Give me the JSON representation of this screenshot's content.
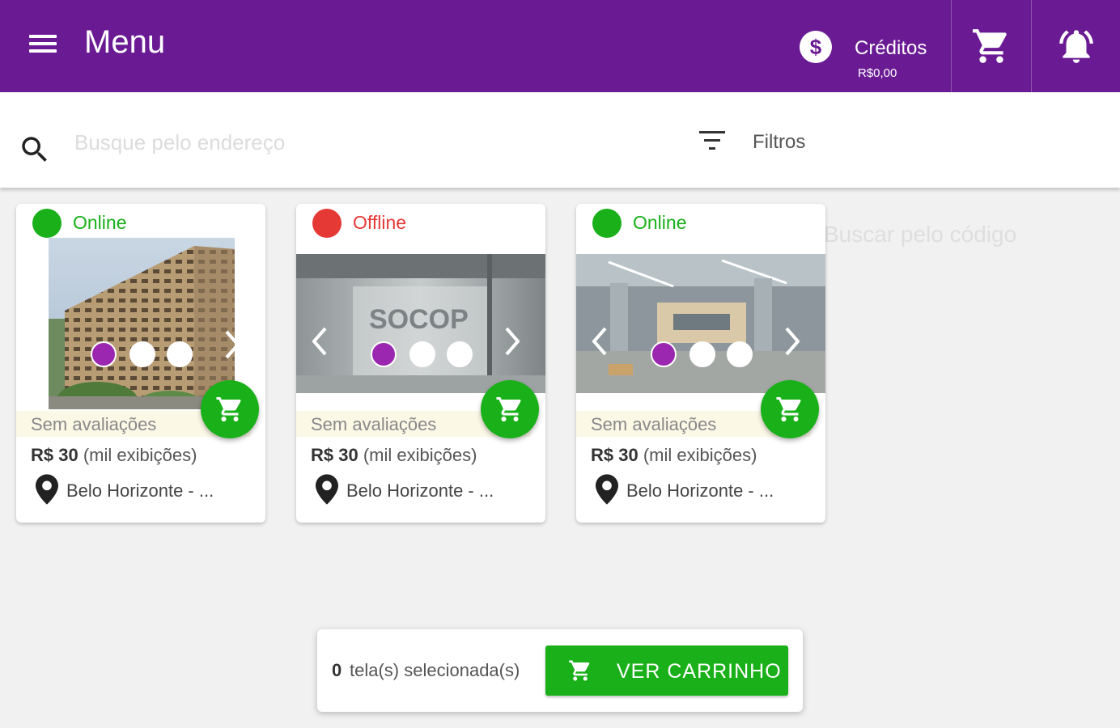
{
  "header": {
    "title": "Menu",
    "credits_label": "Créditos",
    "credits_value": "R$0,00",
    "icons": [
      "menu-icon",
      "dollar-coin-icon",
      "cart-icon",
      "bell-icon"
    ],
    "background_color": "#6a1b94"
  },
  "search": {
    "placeholder": "Busque pelo endereço",
    "filters_label": "Filtros",
    "code_placeholder": "Buscar pelo código"
  },
  "cards": [
    {
      "status": "Online",
      "status_color": "#1ab01a",
      "rating": "Sem avaliações",
      "price_bold": "R$ 30",
      "price_rest": " (mil exibições)",
      "location": "Belo Horizonte - ...",
      "carousel_active_index": 0
    },
    {
      "status": "Offline",
      "status_color": "#e53935",
      "rating": "Sem avaliações",
      "price_bold": "R$ 30",
      "price_rest": " (mil exibições)",
      "location": "Belo Horizonte - ...",
      "carousel_active_index": 0
    },
    {
      "status": "Online",
      "status_color": "#1ab01a",
      "rating": "Sem avaliações",
      "price_bold": "R$ 30",
      "price_rest": " (mil exibições)",
      "location": "Belo Horizonte - ...",
      "carousel_active_index": 0
    }
  ],
  "cart_bar": {
    "count": "0",
    "selected_text": "tela(s) selecionada(s)",
    "button_label": "VER CARRINHO",
    "button_color": "#1ab01a"
  }
}
